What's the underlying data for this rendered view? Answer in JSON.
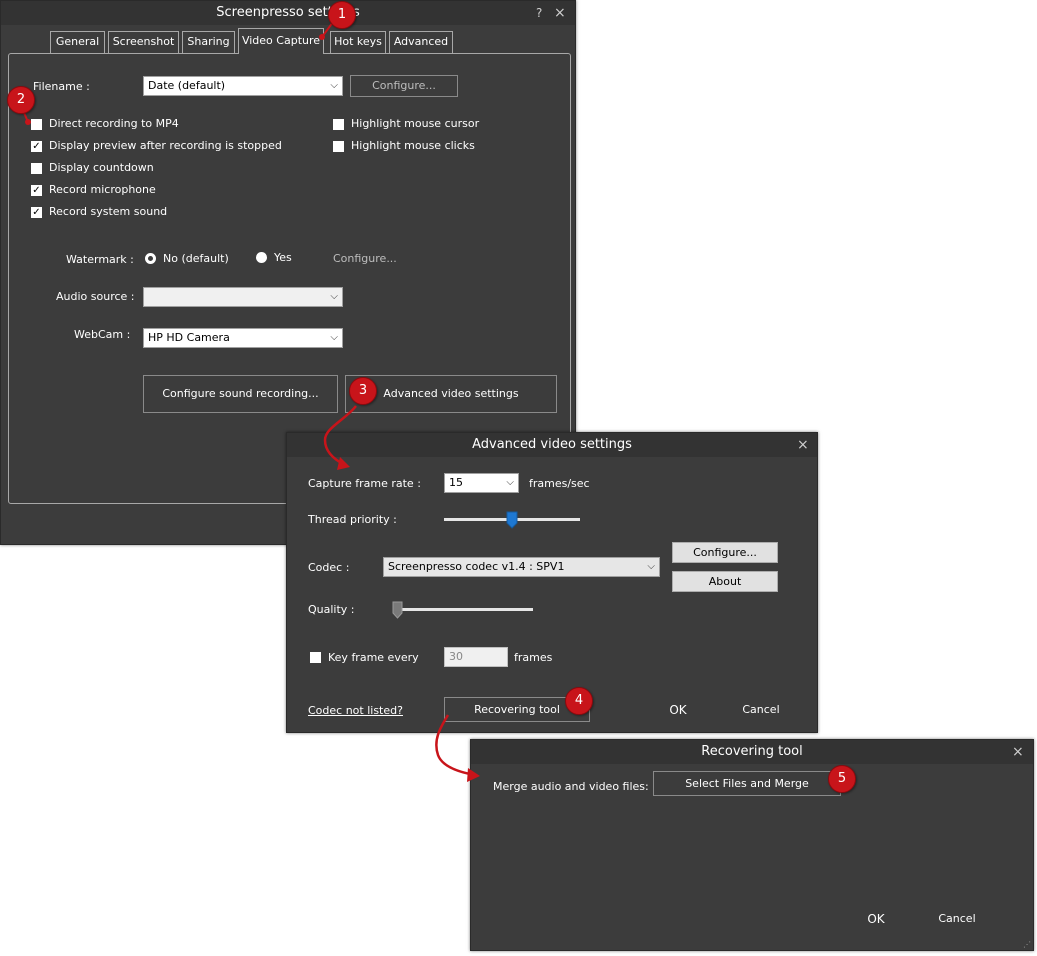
{
  "main_window": {
    "title": "Screenpresso settings",
    "help_label": "?",
    "close_label": "×",
    "tabs": [
      {
        "label": "General"
      },
      {
        "label": "Screenshot"
      },
      {
        "label": "Sharing"
      },
      {
        "label": "Video Capture"
      },
      {
        "label": "Hot keys"
      },
      {
        "label": "Advanced"
      }
    ],
    "active_tab": "Video Capture",
    "filename_label": "Filename :",
    "filename_value": "Date (default)",
    "filename_configure": "Configure...",
    "checkboxes": [
      {
        "label": "Direct recording to MP4",
        "checked": false
      },
      {
        "label": "Display preview after recording is stopped",
        "checked": true
      },
      {
        "label": "Display countdown",
        "checked": false
      },
      {
        "label": "Record microphone",
        "checked": true
      },
      {
        "label": "Record system sound",
        "checked": true
      }
    ],
    "right_checkboxes": [
      {
        "label": "Highlight mouse cursor",
        "checked": false
      },
      {
        "label": "Highlight mouse clicks",
        "checked": false
      }
    ],
    "watermark_label": "Watermark :",
    "watermark_options": [
      {
        "label": "No (default)",
        "selected": true
      },
      {
        "label": "Yes",
        "selected": false
      }
    ],
    "watermark_configure": "Configure...",
    "audio_source_label": "Audio source :",
    "audio_source_value": "",
    "webcam_label": "WebCam :",
    "webcam_value": "HP HD Camera",
    "configure_sound_button": "Configure sound recording...",
    "advanced_video_button": "Advanced video settings"
  },
  "advanced_window": {
    "title": "Advanced video settings",
    "close_label": "×",
    "frame_rate_label": "Capture frame rate :",
    "frame_rate_value": "15",
    "frame_rate_unit": "frames/sec",
    "thread_priority_label": "Thread priority :",
    "thread_priority_level": 0.5,
    "codec_label": "Codec :",
    "codec_value": "Screenpresso codec v1.4 : SPV1",
    "configure_button": "Configure...",
    "about_button": "About",
    "quality_label": "Quality :",
    "quality_level": 0.0,
    "keyframe_label": "Key frame every",
    "keyframe_checked": false,
    "keyframe_value": "30",
    "keyframe_unit": "frames",
    "codec_not_listed_link": "Codec not listed?",
    "recovering_tool_button": "Recovering tool",
    "ok_button": "OK",
    "cancel_button": "Cancel"
  },
  "recovering_window": {
    "title": "Recovering tool",
    "close_label": "×",
    "merge_label": "Merge audio and video files:",
    "select_merge_button": "Select Files and Merge",
    "ok_button": "OK",
    "cancel_button": "Cancel"
  },
  "markers": [
    "1",
    "2",
    "3",
    "4",
    "5"
  ],
  "colors": {
    "window_bg": "#3c3c3c",
    "titlebar_bg": "#333333",
    "marker_red": "#c8141a",
    "slider_thumb_blue": "#1e78d2"
  }
}
